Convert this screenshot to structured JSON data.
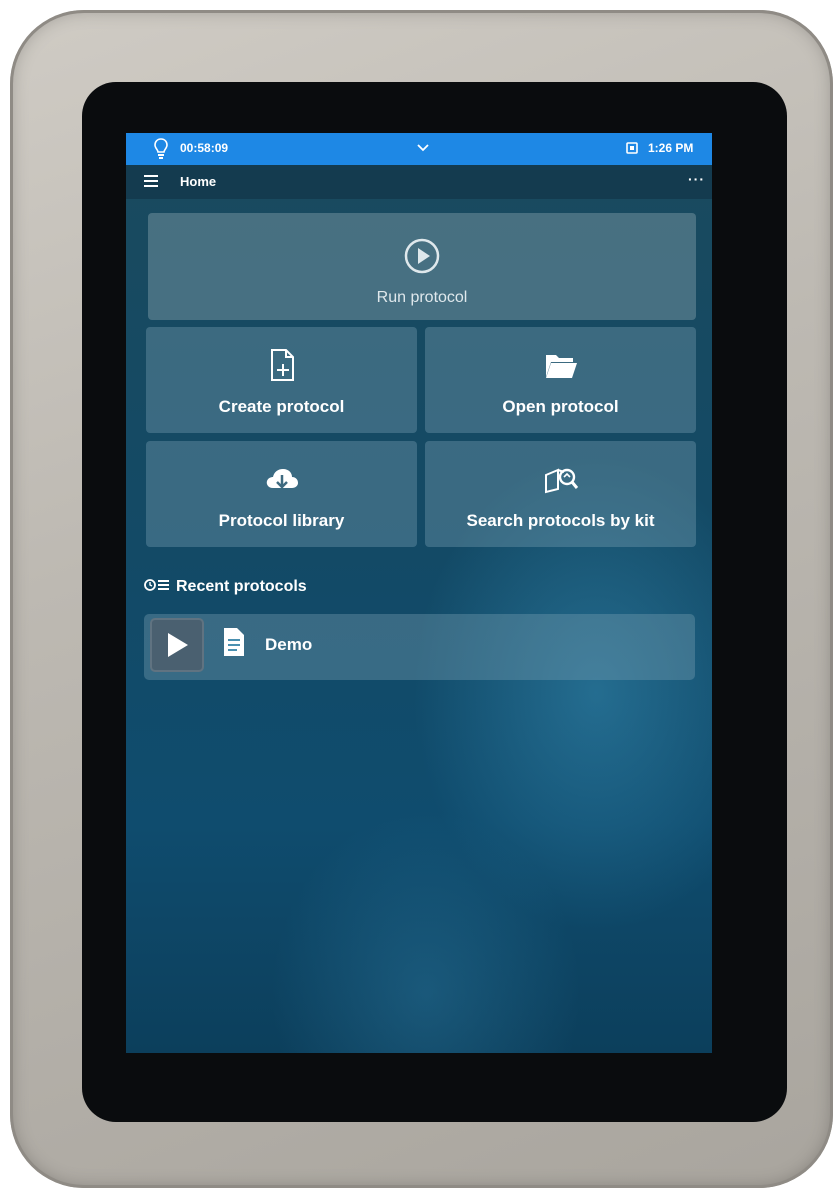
{
  "status_bar": {
    "timer": "00:58:09",
    "clock": "1:26 PM",
    "icons": [
      "lightbulb-icon",
      "chevron-down-icon",
      "tray-icon"
    ],
    "color": "#1e88e5"
  },
  "title_bar": {
    "title": "Home",
    "more": "···",
    "icons": [
      "hamburger-menu-icon",
      "more-icon"
    ]
  },
  "tiles": {
    "run": {
      "label": "Run protocol",
      "icon": "play-circle-icon"
    },
    "create": {
      "label": "Create protocol",
      "icon": "new-document-icon"
    },
    "open": {
      "label": "Open protocol",
      "icon": "open-folder-icon"
    },
    "library": {
      "label": "Protocol library",
      "icon": "cloud-download-icon"
    },
    "search": {
      "label": "Search protocols by kit",
      "icon": "kit-search-icon"
    }
  },
  "recent": {
    "header": "Recent protocols",
    "items": [
      {
        "name": "Demo",
        "icons": [
          "play-icon",
          "document-icon"
        ]
      }
    ]
  }
}
